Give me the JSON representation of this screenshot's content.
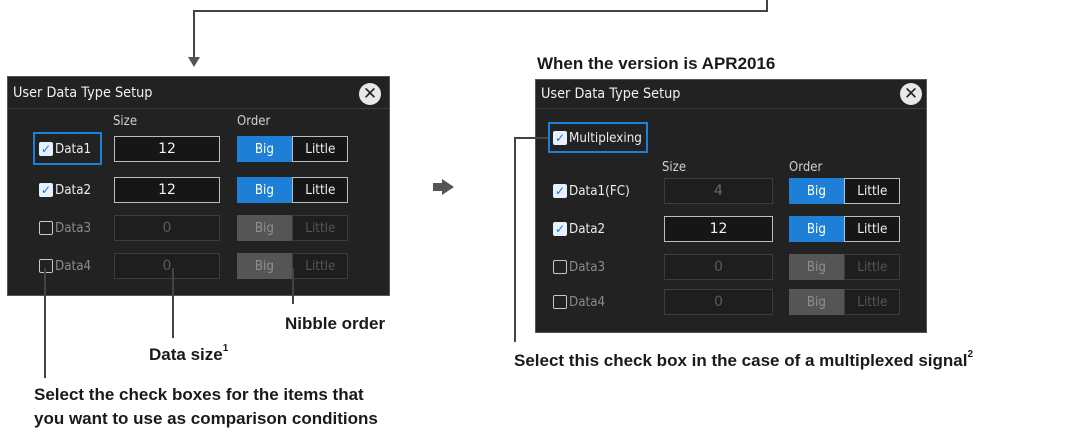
{
  "left_panel": {
    "title": "User Data Type Setup",
    "col_size": "Size",
    "col_order": "Order",
    "rows": [
      {
        "label": "Data1",
        "checked": true,
        "size": "12",
        "big": "Big",
        "little": "Little"
      },
      {
        "label": "Data2",
        "checked": true,
        "size": "12",
        "big": "Big",
        "little": "Little"
      },
      {
        "label": "Data3",
        "checked": false,
        "size": "0",
        "big": "Big",
        "little": "Little"
      },
      {
        "label": "Data4",
        "checked": false,
        "size": "0",
        "big": "Big",
        "little": "Little"
      }
    ]
  },
  "right_panel": {
    "heading": "When the version is APR2016",
    "title": "User Data Type Setup",
    "multiplexing": {
      "label": "Multiplexing",
      "checked": true
    },
    "col_size": "Size",
    "col_order": "Order",
    "rows": [
      {
        "label": "Data1(FC)",
        "checked": true,
        "size": "4",
        "big": "Big",
        "little": "Little"
      },
      {
        "label": "Data2",
        "checked": true,
        "size": "12",
        "big": "Big",
        "little": "Little"
      },
      {
        "label": "Data3",
        "checked": false,
        "size": "0",
        "big": "Big",
        "little": "Little"
      },
      {
        "label": "Data4",
        "checked": false,
        "size": "0",
        "big": "Big",
        "little": "Little"
      }
    ]
  },
  "callouts": {
    "nibble_order": "Nibble order",
    "data_size": "Data size",
    "data_size_note": "1",
    "check_boxes_line1": "Select the check boxes for the items that",
    "check_boxes_line2": "you want to use as comparison conditions",
    "multiplexed": "Select this check box in the case of a multiplexed signal",
    "multiplexed_note": "2"
  },
  "colors": {
    "accent": "#1e7fd6",
    "panel_bg": "#222222"
  },
  "icons": {
    "close": "close-icon",
    "check": "check-icon"
  }
}
